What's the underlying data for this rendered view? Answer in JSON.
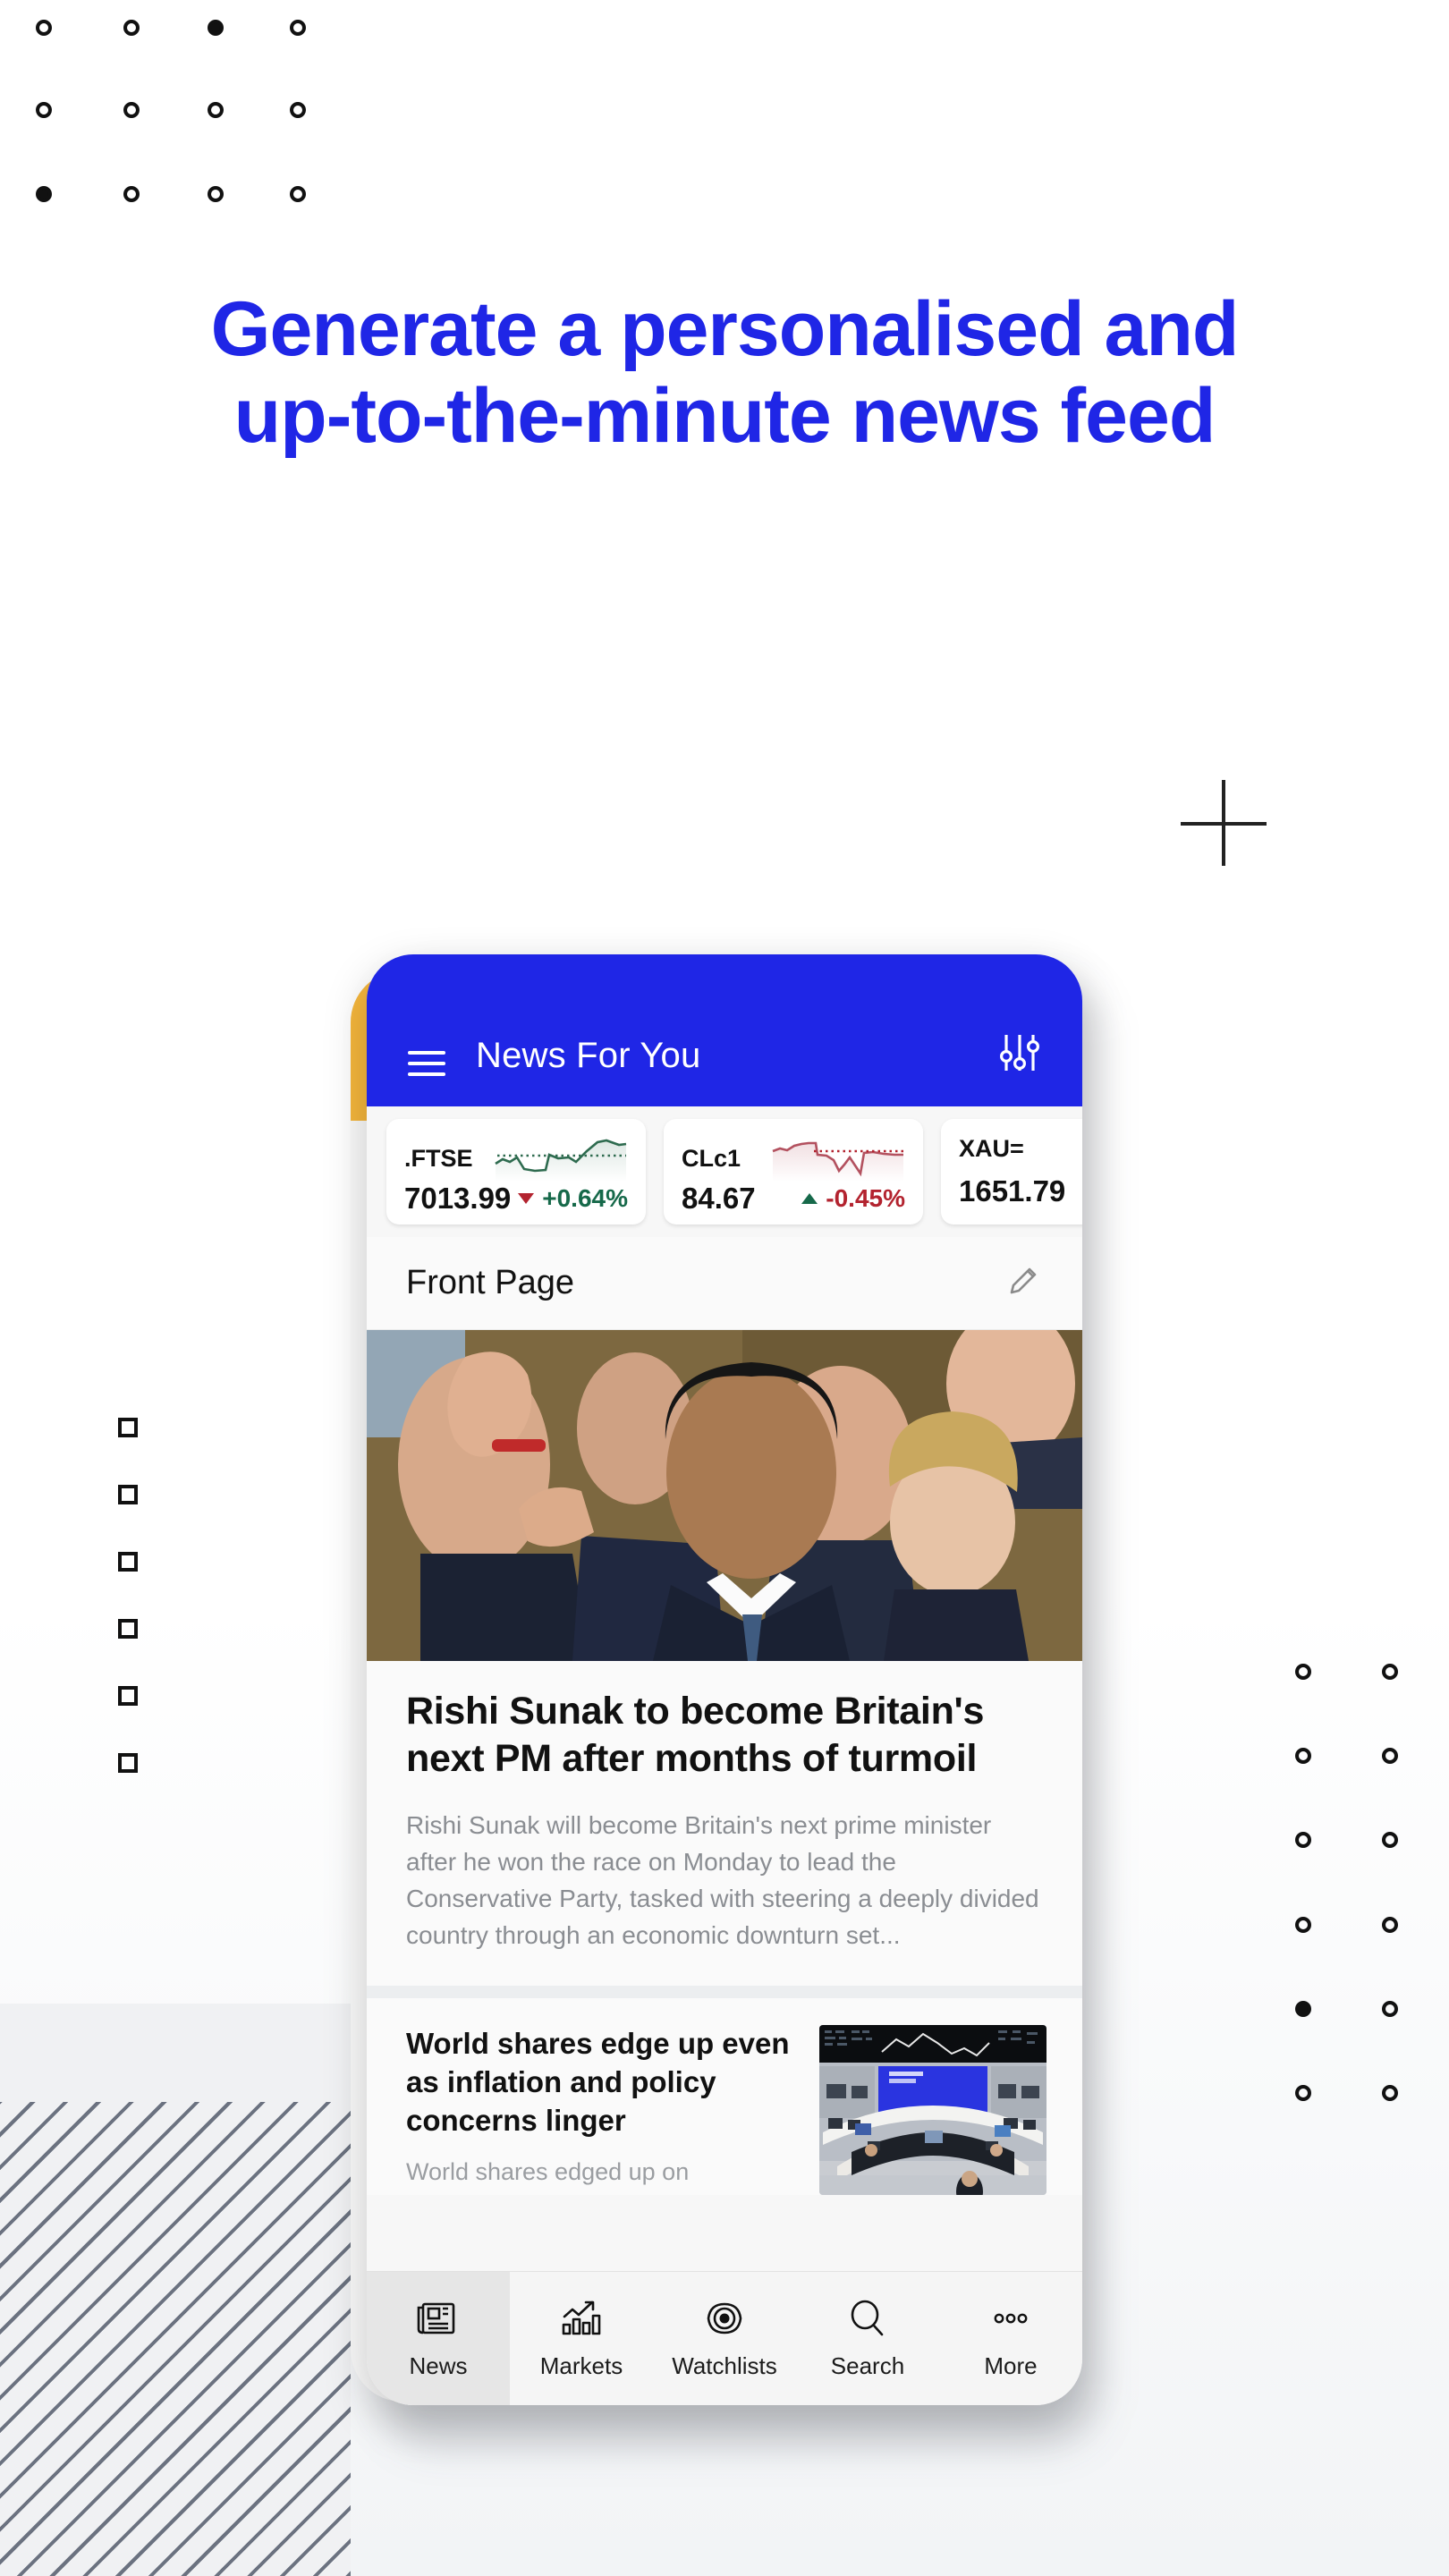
{
  "headline": "Generate a personalised and up-to-the-minute news feed",
  "brand_color": "#1f26e6",
  "app": {
    "appbar": {
      "menu_icon": "hamburger-menu-icon",
      "title": "News For You",
      "filter_icon": "sliders-filter-icon"
    },
    "tickers": [
      {
        "symbol": ".FTSE",
        "price": "7013.99",
        "change": "+0.64%",
        "direction": "down",
        "change_color": "#16694a",
        "spark_color": "#2e6b4f"
      },
      {
        "symbol": "CLc1",
        "price": "84.67",
        "change": "-0.45%",
        "direction": "up",
        "change_color": "#b3232f",
        "spark_color": "#b3515f"
      },
      {
        "symbol": "XAU=",
        "price": "1651.79",
        "change": "",
        "direction": "none",
        "change_color": "#16694a",
        "spark_color": "#2e6b4f"
      }
    ],
    "section": {
      "title": "Front Page",
      "edit_icon": "pencil-edit-icon"
    },
    "hero_article": {
      "image_alt": "Rishi Sunak waving surrounded by applauding supporters",
      "headline": "Rishi Sunak to become Britain's next PM after months of turmoil",
      "summary": "Rishi Sunak will become Britain's next prime minister after he won the race on Monday to lead the Conservative Party, tasked with steering a deeply divided country through an economic downturn set..."
    },
    "second_article": {
      "image_alt": "Trading floor of the Frankfurt stock exchange",
      "headline": "World shares edge up even as inflation and policy concerns linger",
      "summary": "World shares edged up on"
    },
    "tabs": [
      {
        "label": "News",
        "icon": "newspaper-icon",
        "active": true
      },
      {
        "label": "Markets",
        "icon": "bar-chart-up-icon",
        "active": false
      },
      {
        "label": "Watchlists",
        "icon": "eye-icon",
        "active": false
      },
      {
        "label": "Search",
        "icon": "search-icon",
        "active": false
      },
      {
        "label": "More",
        "icon": "ellipsis-icon",
        "active": false
      }
    ]
  },
  "decor": {
    "plus_mark": "plus-crosshair-mark",
    "hatch": "diagonal-stripe-pattern",
    "top_rings": "ring-grid-top-left",
    "left_squares": "square-column-left",
    "right_rings": "ring-grid-right"
  }
}
